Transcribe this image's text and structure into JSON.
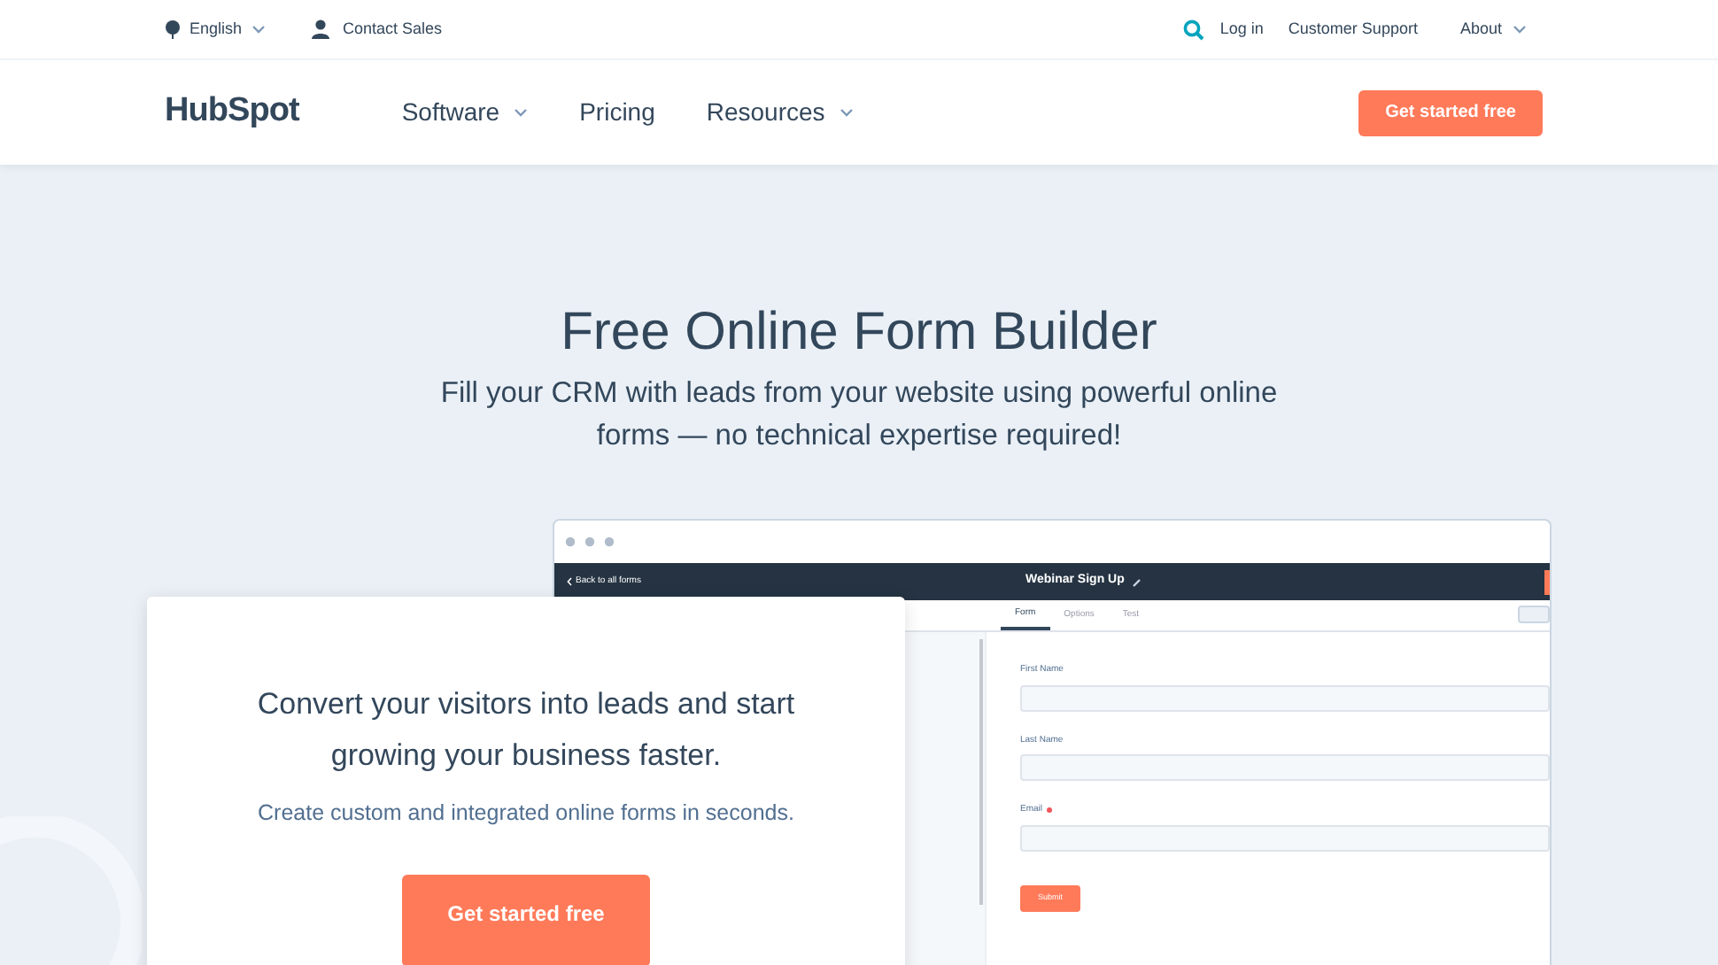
{
  "top_bar": {
    "language": "English",
    "contact": "Contact Sales",
    "login": "Log in",
    "support": "Customer Support",
    "about": "About"
  },
  "nav": {
    "logo": "HubSpot",
    "items": [
      {
        "label": "Software",
        "dropdown": true
      },
      {
        "label": "Pricing",
        "dropdown": false
      },
      {
        "label": "Resources",
        "dropdown": true
      }
    ],
    "cta": "Get started free"
  },
  "hero": {
    "title": "Free Online Form Builder",
    "subtitle_lines": [
      "Fill your CRM with leads from your website using powerful online",
      "forms — no technical expertise required!"
    ]
  },
  "mockup": {
    "back": "Back to all forms",
    "form_title": "Webinar Sign Up",
    "tabs": [
      {
        "label": "Form",
        "selected": true
      },
      {
        "label": "Options",
        "selected": false
      },
      {
        "label": "Test",
        "selected": false
      }
    ],
    "fields": [
      {
        "label": "First Name",
        "required": false
      },
      {
        "label": "Last Name",
        "required": false
      },
      {
        "label": "Email",
        "required": true
      }
    ],
    "submit": "Submit"
  },
  "card": {
    "heading_lines": [
      "Convert your visitors into leads and start",
      "growing your business faster."
    ],
    "text": "Create custom and integrated online forms in seconds.",
    "button": "Get started free"
  }
}
